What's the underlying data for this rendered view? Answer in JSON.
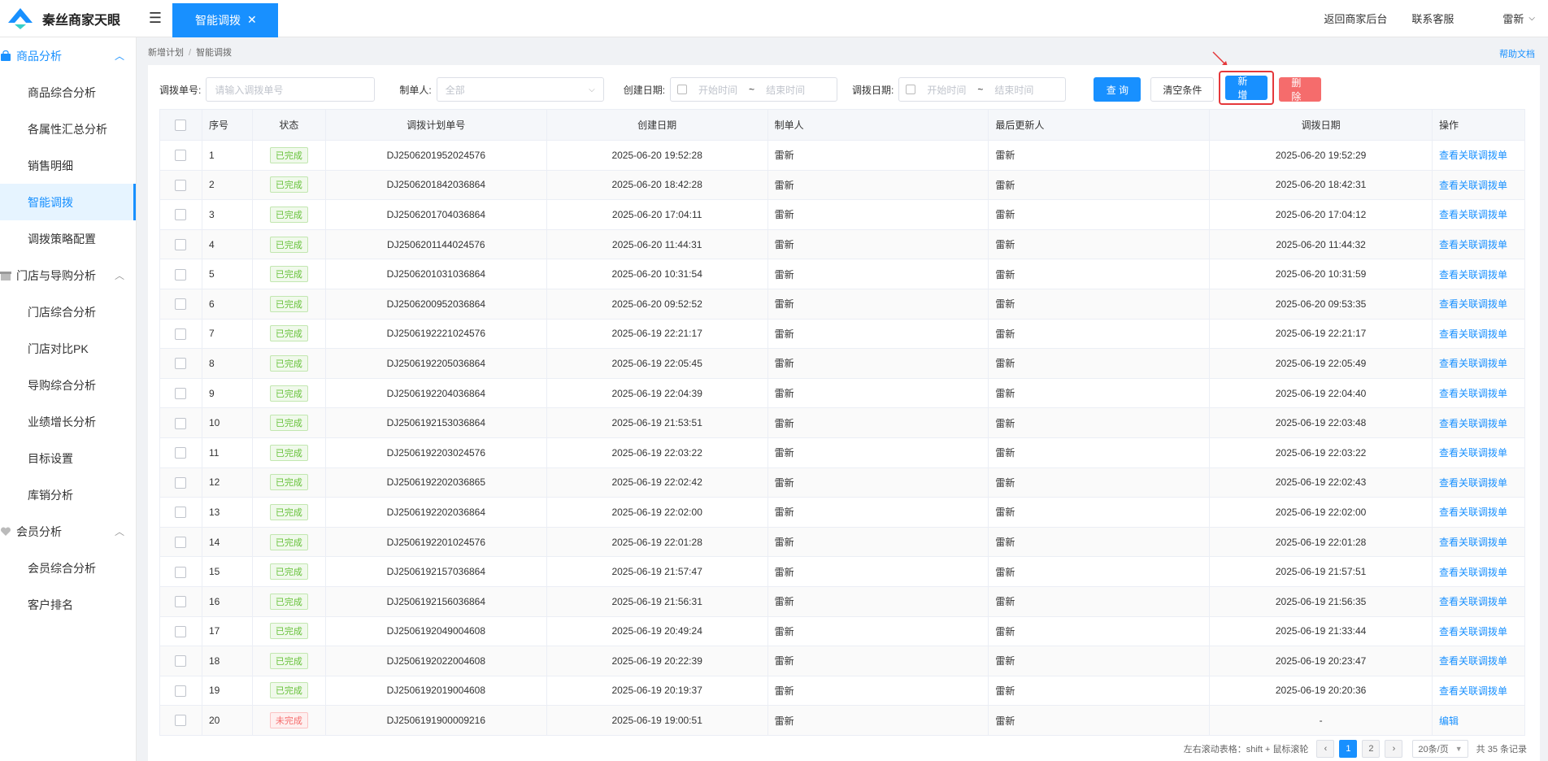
{
  "app": {
    "title": "秦丝商家天眼",
    "active_tab": "智能调拨",
    "tab_close": "✕",
    "menu_toggle": "☰"
  },
  "header": {
    "links": [
      "返回商家后台",
      "联系客服"
    ],
    "user": "雷新",
    "user_chevron": "⌵"
  },
  "sidebar": {
    "groups": [
      {
        "label": "商品分析",
        "icon": "bag-icon",
        "expanded": true,
        "items": [
          "商品综合分析",
          "各属性汇总分析",
          "销售明细",
          "智能调拨",
          "调拨策略配置"
        ]
      },
      {
        "label": "门店与导购分析",
        "icon": "store-icon",
        "expanded": true,
        "items": [
          "门店综合分析",
          "门店对比PK",
          "导购综合分析",
          "业绩增长分析",
          "目标设置",
          "库销分析"
        ]
      },
      {
        "label": "会员分析",
        "icon": "heart-icon",
        "expanded": true,
        "items": [
          "会员综合分析",
          "客户排名"
        ]
      }
    ],
    "active_item": "智能调拨"
  },
  "breadcrumb": {
    "parent": "新增计划",
    "separator": "/",
    "current": "智能调拨"
  },
  "help_link": "帮助文档",
  "filters": {
    "order_no_label": "调拨单号:",
    "order_no_placeholder": "请输入调拨单号",
    "maker_label": "制单人:",
    "maker_value": "全部",
    "create_date_label": "创建日期:",
    "transfer_date_label": "调拨日期:",
    "start_placeholder": "开始时间",
    "end_placeholder": "结束时间",
    "range_sep": "~",
    "query_btn": "查 询",
    "clear_btn": "清空条件",
    "add_btn": "新增",
    "delete_btn": "删除"
  },
  "table": {
    "columns": [
      "序号",
      "状态",
      "调拨计划单号",
      "创建日期",
      "制单人",
      "最后更新人",
      "调拨日期",
      "操作"
    ],
    "rows": [
      {
        "no": "1",
        "status": "已完成",
        "done": true,
        "plan": "DJ2506201952024576",
        "created": "2025-06-20 19:52:28",
        "maker": "雷新",
        "updater": "雷新",
        "transfer": "2025-06-20 19:52:29",
        "op": "查看关联调拨单"
      },
      {
        "no": "2",
        "status": "已完成",
        "done": true,
        "plan": "DJ2506201842036864",
        "created": "2025-06-20 18:42:28",
        "maker": "雷新",
        "updater": "雷新",
        "transfer": "2025-06-20 18:42:31",
        "op": "查看关联调拨单"
      },
      {
        "no": "3",
        "status": "已完成",
        "done": true,
        "plan": "DJ2506201704036864",
        "created": "2025-06-20 17:04:11",
        "maker": "雷新",
        "updater": "雷新",
        "transfer": "2025-06-20 17:04:12",
        "op": "查看关联调拨单"
      },
      {
        "no": "4",
        "status": "已完成",
        "done": true,
        "plan": "DJ2506201144024576",
        "created": "2025-06-20 11:44:31",
        "maker": "雷新",
        "updater": "雷新",
        "transfer": "2025-06-20 11:44:32",
        "op": "查看关联调拨单"
      },
      {
        "no": "5",
        "status": "已完成",
        "done": true,
        "plan": "DJ2506201031036864",
        "created": "2025-06-20 10:31:54",
        "maker": "雷新",
        "updater": "雷新",
        "transfer": "2025-06-20 10:31:59",
        "op": "查看关联调拨单"
      },
      {
        "no": "6",
        "status": "已完成",
        "done": true,
        "plan": "DJ2506200952036864",
        "created": "2025-06-20 09:52:52",
        "maker": "雷新",
        "updater": "雷新",
        "transfer": "2025-06-20 09:53:35",
        "op": "查看关联调拨单"
      },
      {
        "no": "7",
        "status": "已完成",
        "done": true,
        "plan": "DJ2506192221024576",
        "created": "2025-06-19 22:21:17",
        "maker": "雷新",
        "updater": "雷新",
        "transfer": "2025-06-19 22:21:17",
        "op": "查看关联调拨单"
      },
      {
        "no": "8",
        "status": "已完成",
        "done": true,
        "plan": "DJ2506192205036864",
        "created": "2025-06-19 22:05:45",
        "maker": "雷新",
        "updater": "雷新",
        "transfer": "2025-06-19 22:05:49",
        "op": "查看关联调拨单"
      },
      {
        "no": "9",
        "status": "已完成",
        "done": true,
        "plan": "DJ2506192204036864",
        "created": "2025-06-19 22:04:39",
        "maker": "雷新",
        "updater": "雷新",
        "transfer": "2025-06-19 22:04:40",
        "op": "查看关联调拨单"
      },
      {
        "no": "10",
        "status": "已完成",
        "done": true,
        "plan": "DJ2506192153036864",
        "created": "2025-06-19 21:53:51",
        "maker": "雷新",
        "updater": "雷新",
        "transfer": "2025-06-19 22:03:48",
        "op": "查看关联调拨单"
      },
      {
        "no": "11",
        "status": "已完成",
        "done": true,
        "plan": "DJ2506192203024576",
        "created": "2025-06-19 22:03:22",
        "maker": "雷新",
        "updater": "雷新",
        "transfer": "2025-06-19 22:03:22",
        "op": "查看关联调拨单"
      },
      {
        "no": "12",
        "status": "已完成",
        "done": true,
        "plan": "DJ2506192202036865",
        "created": "2025-06-19 22:02:42",
        "maker": "雷新",
        "updater": "雷新",
        "transfer": "2025-06-19 22:02:43",
        "op": "查看关联调拨单"
      },
      {
        "no": "13",
        "status": "已完成",
        "done": true,
        "plan": "DJ2506192202036864",
        "created": "2025-06-19 22:02:00",
        "maker": "雷新",
        "updater": "雷新",
        "transfer": "2025-06-19 22:02:00",
        "op": "查看关联调拨单"
      },
      {
        "no": "14",
        "status": "已完成",
        "done": true,
        "plan": "DJ2506192201024576",
        "created": "2025-06-19 22:01:28",
        "maker": "雷新",
        "updater": "雷新",
        "transfer": "2025-06-19 22:01:28",
        "op": "查看关联调拨单"
      },
      {
        "no": "15",
        "status": "已完成",
        "done": true,
        "plan": "DJ2506192157036864",
        "created": "2025-06-19 21:57:47",
        "maker": "雷新",
        "updater": "雷新",
        "transfer": "2025-06-19 21:57:51",
        "op": "查看关联调拨单"
      },
      {
        "no": "16",
        "status": "已完成",
        "done": true,
        "plan": "DJ2506192156036864",
        "created": "2025-06-19 21:56:31",
        "maker": "雷新",
        "updater": "雷新",
        "transfer": "2025-06-19 21:56:35",
        "op": "查看关联调拨单"
      },
      {
        "no": "17",
        "status": "已完成",
        "done": true,
        "plan": "DJ2506192049004608",
        "created": "2025-06-19 20:49:24",
        "maker": "雷新",
        "updater": "雷新",
        "transfer": "2025-06-19 21:33:44",
        "op": "查看关联调拨单"
      },
      {
        "no": "18",
        "status": "已完成",
        "done": true,
        "plan": "DJ2506192022004608",
        "created": "2025-06-19 20:22:39",
        "maker": "雷新",
        "updater": "雷新",
        "transfer": "2025-06-19 20:23:47",
        "op": "查看关联调拨单"
      },
      {
        "no": "19",
        "status": "已完成",
        "done": true,
        "plan": "DJ2506192019004608",
        "created": "2025-06-19 20:19:37",
        "maker": "雷新",
        "updater": "雷新",
        "transfer": "2025-06-19 20:20:36",
        "op": "查看关联调拨单"
      },
      {
        "no": "20",
        "status": "未完成",
        "done": false,
        "plan": "DJ2506191900009216",
        "created": "2025-06-19 19:00:51",
        "maker": "雷新",
        "updater": "雷新",
        "transfer": "-",
        "op": "编辑"
      }
    ]
  },
  "pagination": {
    "hint": "左右滚动表格：shift + 鼠标滚轮",
    "prev": "‹",
    "pages": [
      "1",
      "2"
    ],
    "current": "1",
    "next": "›",
    "page_size": "20条/页",
    "total": "共 35 条记录"
  },
  "colors": {
    "primary": "#1890ff",
    "danger": "#f56c6c",
    "success": "#67c23a",
    "annotation": "#e5383b"
  }
}
